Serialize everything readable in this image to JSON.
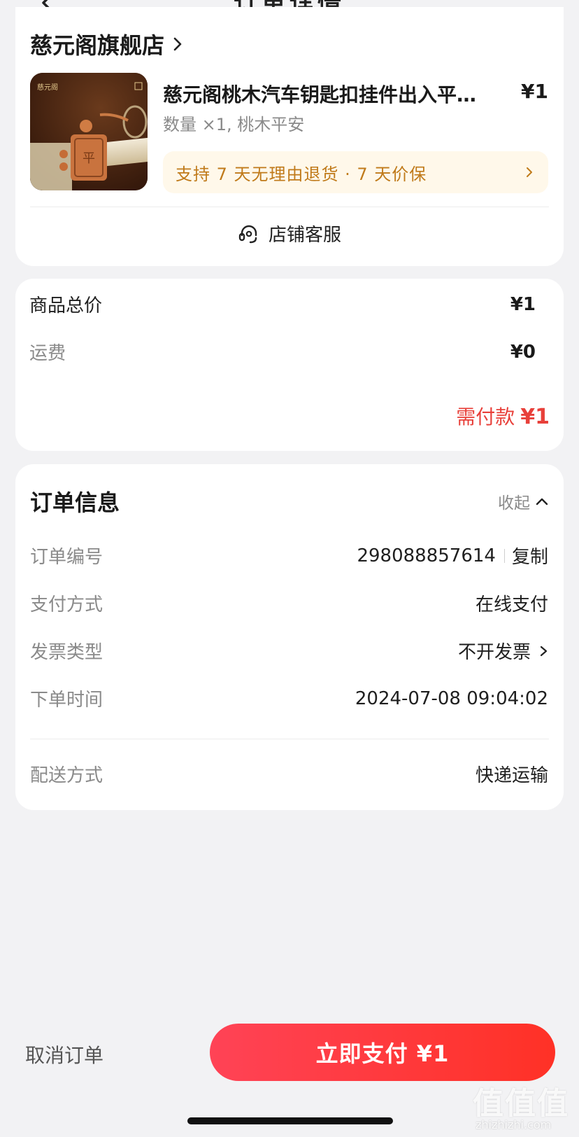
{
  "nav": {
    "title": "订单详情"
  },
  "store": {
    "name": "慈元阁旗舰店",
    "product": {
      "title": "慈元阁桃木汽车钥匙扣挂件出入平…",
      "price": "¥1",
      "spec": "数量 ×1, 桃木平安",
      "image_text": "慈元阁"
    },
    "guarantee": "支持 7 天无理由退货 · 7 天价保",
    "service_label": "店铺客服"
  },
  "price": {
    "goods_label": "商品总价",
    "goods_value": "¥1",
    "shipping_label": "运费",
    "shipping_value": "¥0",
    "due_label": "需付款",
    "due_value": "¥1"
  },
  "order_info": {
    "title": "订单信息",
    "collapse_label": "收起",
    "rows": [
      {
        "key": "订单编号",
        "value": "298088857614"
      },
      {
        "key": "支付方式",
        "value": "在线支付"
      },
      {
        "key": "发票类型",
        "value": "不开发票"
      },
      {
        "key": "下单时间",
        "value": "2024-07-08 09:04:02"
      },
      {
        "key": "配送方式",
        "value": "快递运输"
      }
    ],
    "copy_label": "复制"
  },
  "bottom": {
    "cancel_label": "取消订单",
    "pay_label": "立即支付 ¥1"
  },
  "watermark": {
    "logo": "值值值",
    "url": "zhizhizhi.com"
  },
  "colors": {
    "accent_red": "#e8403a",
    "pay_gradient_start": "#ff4356",
    "pay_gradient_end": "#ff3126",
    "guarantee_text": "#c07a1a",
    "guarantee_bg": "#fff8ea",
    "page_bg": "#f2f2f4"
  },
  "icons": [
    "back-arrow-icon",
    "chevron-right-icon",
    "headset-icon",
    "chevron-up-icon"
  ]
}
